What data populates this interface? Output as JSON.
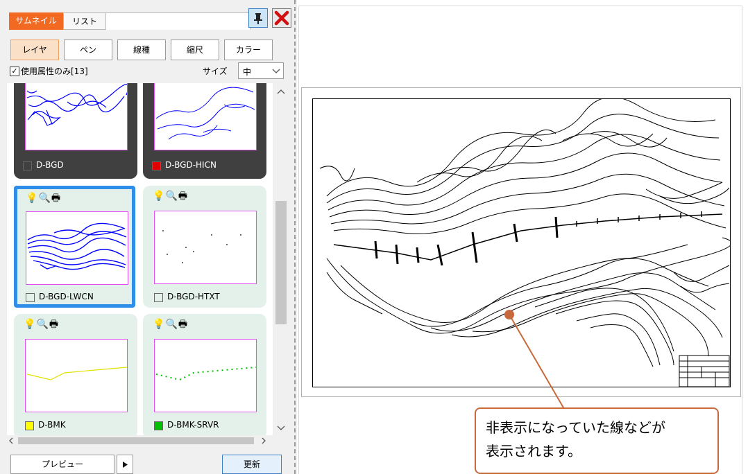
{
  "panel": {
    "tabs": [
      {
        "label": "サムネイル",
        "active": true
      },
      {
        "label": "リスト",
        "active": false
      }
    ],
    "pin_icon": "pin-icon",
    "close_icon": "close-icon",
    "filters": [
      {
        "label": "レイヤ",
        "active": true
      },
      {
        "label": "ペン",
        "active": false
      },
      {
        "label": "線種",
        "active": false
      },
      {
        "label": "縮尺",
        "active": false
      },
      {
        "label": "カラー",
        "active": false
      }
    ],
    "used_only_label": "使用属性のみ[13]",
    "used_only_checked": true,
    "size_label": "サイズ",
    "size_value": "中",
    "layers": [
      {
        "name": "D-BGD",
        "color": "#ffffff",
        "theme": "dark",
        "stroke": "#0000ff",
        "selected": false,
        "icons": false
      },
      {
        "name": "D-BGD-HICN",
        "color": "#e00000",
        "theme": "dark",
        "stroke": "#0000ff",
        "selected": false,
        "icons": false
      },
      {
        "name": "D-BGD-LWCN",
        "color": "#ffffff",
        "theme": "light",
        "stroke": "#0000ff",
        "selected": true,
        "icons": true
      },
      {
        "name": "D-BGD-HTXT",
        "color": "#ffffff",
        "theme": "light",
        "stroke": "#000000",
        "selected": false,
        "icons": true
      },
      {
        "name": "D-BMK",
        "color": "#ffff00",
        "theme": "light",
        "stroke": "#e0e000",
        "selected": false,
        "icons": true
      },
      {
        "name": "D-BMK-SRVR",
        "color": "#00c000",
        "theme": "light",
        "stroke": "#00c000",
        "selected": false,
        "icons": true
      }
    ],
    "preview_label": "プレビュー",
    "update_label": "更新"
  },
  "callout": {
    "line1": "非表示になっていた線などが",
    "line2": "表示されます。",
    "color": "#c8693b"
  }
}
